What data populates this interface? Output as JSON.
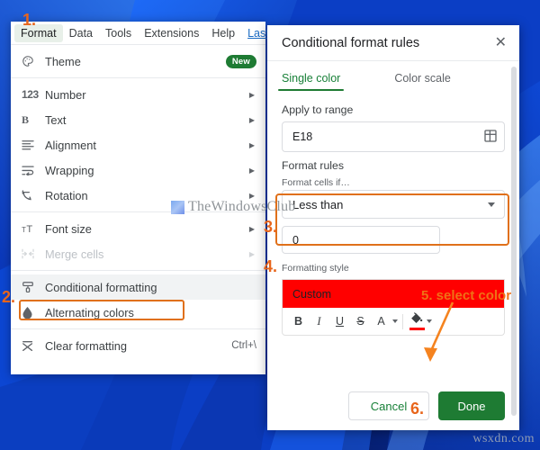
{
  "menubar": {
    "items": [
      {
        "label": "Format",
        "state": "active"
      },
      {
        "label": "Data",
        "state": "normal"
      },
      {
        "label": "Tools",
        "state": "normal"
      },
      {
        "label": "Extensions",
        "state": "normal"
      },
      {
        "label": "Help",
        "state": "normal"
      },
      {
        "label": "Last",
        "state": "link"
      }
    ]
  },
  "format_menu": {
    "items": [
      {
        "label": "Theme",
        "icon": "palette-icon",
        "badge": "New",
        "arrow": false,
        "accel": "",
        "highlight": false,
        "disabled": false
      },
      {
        "label": "Number",
        "icon": "number-123-icon",
        "badge": "",
        "arrow": true,
        "accel": "",
        "highlight": false,
        "disabled": false
      },
      {
        "label": "Text",
        "icon": "bold-b-icon",
        "badge": "",
        "arrow": true,
        "accel": "",
        "highlight": false,
        "disabled": false
      },
      {
        "label": "Alignment",
        "icon": "alignment-icon",
        "badge": "",
        "arrow": true,
        "accel": "",
        "highlight": false,
        "disabled": false
      },
      {
        "label": "Wrapping",
        "icon": "wrapping-icon",
        "badge": "",
        "arrow": true,
        "accel": "",
        "highlight": false,
        "disabled": false
      },
      {
        "label": "Rotation",
        "icon": "rotation-icon",
        "badge": "",
        "arrow": true,
        "accel": "",
        "highlight": false,
        "disabled": false
      },
      {
        "label": "Font size",
        "icon": "font-size-icon",
        "badge": "",
        "arrow": true,
        "accel": "",
        "highlight": false,
        "disabled": false
      },
      {
        "label": "Merge cells",
        "icon": "merge-cells-icon",
        "badge": "",
        "arrow": true,
        "accel": "",
        "highlight": false,
        "disabled": true
      },
      {
        "label": "Conditional formatting",
        "icon": "paint-roller-icon",
        "badge": "",
        "arrow": false,
        "accel": "",
        "highlight": true,
        "disabled": false
      },
      {
        "label": "Alternating colors",
        "icon": "droplet-icon",
        "badge": "",
        "arrow": false,
        "accel": "",
        "highlight": false,
        "disabled": false
      },
      {
        "label": "Clear formatting",
        "icon": "clear-formatting-icon",
        "badge": "",
        "arrow": false,
        "accel": "Ctrl+\\",
        "highlight": false,
        "disabled": false
      }
    ]
  },
  "cf_panel": {
    "title": "Conditional format rules",
    "close_label": "✕",
    "tabs": [
      {
        "label": "Single color",
        "selected": true
      },
      {
        "label": "Color scale",
        "selected": false
      }
    ],
    "apply_to_range_label": "Apply to range",
    "range_value": "E18",
    "range_picker_icon": "grid-select-icon",
    "format_rules_label": "Format rules",
    "format_cells_if_label": "Format cells if…",
    "condition_value": "Less than",
    "condition_options": [
      "Less than"
    ],
    "threshold_value": "0",
    "formatting_style_label": "Formatting style",
    "style_preview_text": "Custom",
    "style_preview_bg": "#ff0000",
    "toolbar": [
      {
        "label": "B",
        "name": "bold-button"
      },
      {
        "label": "I",
        "name": "italic-button"
      },
      {
        "label": "U",
        "name": "underline-button"
      },
      {
        "label": "S",
        "name": "strikethrough-button"
      },
      {
        "label": "A",
        "name": "text-color-button"
      }
    ],
    "fill_color": "#ff0000",
    "cancel_label": "Cancel",
    "done_label": "Done",
    "done_color": "#1e7b33",
    "cancel_color": "#188038"
  },
  "annotations": {
    "accent": "#e8651b",
    "step1": "1.",
    "step2": "2.",
    "step3": "3.",
    "step4": "4.",
    "step5": "5. select color",
    "step6": "6."
  },
  "watermarks": {
    "top": "TheWindowsClub",
    "bottom": "wsxdn.com"
  }
}
